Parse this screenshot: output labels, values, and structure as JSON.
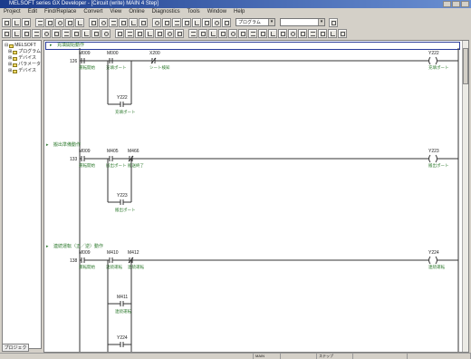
{
  "window": {
    "title": "MELSOFT series GX Developer - [Circuit (write) MAIN 4 Step]"
  },
  "menu": [
    "Project",
    "Edit",
    "Find/Replace",
    "Convert",
    "View",
    "Online",
    "Diagnostics",
    "Tools",
    "Window",
    "Help"
  ],
  "toolbar": {
    "combo_program": "プログラム",
    "combo_blank": ""
  },
  "tree": {
    "root": "MELSOFT",
    "items": [
      "プログラム",
      "デバイス",
      "パラメータ",
      "デバイス"
    ]
  },
  "panel_tab": "プロジェクト",
  "rungs": [
    {
      "step": "126",
      "comment": "充填開始動作",
      "contacts": [
        {
          "device": "M009",
          "label": "運転開始"
        },
        {
          "device": "M000",
          "label": "充填ポート"
        },
        {
          "device": "X200",
          "label": "シート検知"
        }
      ],
      "branch": {
        "device": "Y222",
        "label": "充填ポート"
      },
      "coil": {
        "device": "Y222",
        "label": "充填ポート"
      }
    },
    {
      "step": "133",
      "comment": "搬出準備動作",
      "contacts": [
        {
          "device": "M009",
          "label": "運転開始"
        },
        {
          "device": "M405",
          "label": "搬出ポート"
        },
        {
          "device": "M466",
          "label": "搬送終了"
        }
      ],
      "branch": {
        "device": "Y223",
        "label": "搬出ポート"
      },
      "coil": {
        "device": "Y223",
        "label": "搬出ポート"
      }
    },
    {
      "step": "138",
      "comment": "連続運転（正／逆）動作",
      "contacts": [
        {
          "device": "M009",
          "label": "運転開始"
        },
        {
          "device": "M410",
          "label": "連続運転"
        },
        {
          "device": "M412",
          "label": "連続運転"
        }
      ],
      "branch": {
        "device": "M411",
        "label": "連続運転"
      },
      "branch2": {
        "device": "Y224",
        "label": ""
      },
      "coil": {
        "device": "Y224",
        "label": "連続運転"
      }
    }
  ],
  "status": [
    "",
    "MAIN",
    "",
    "ステップ",
    "",
    ""
  ]
}
